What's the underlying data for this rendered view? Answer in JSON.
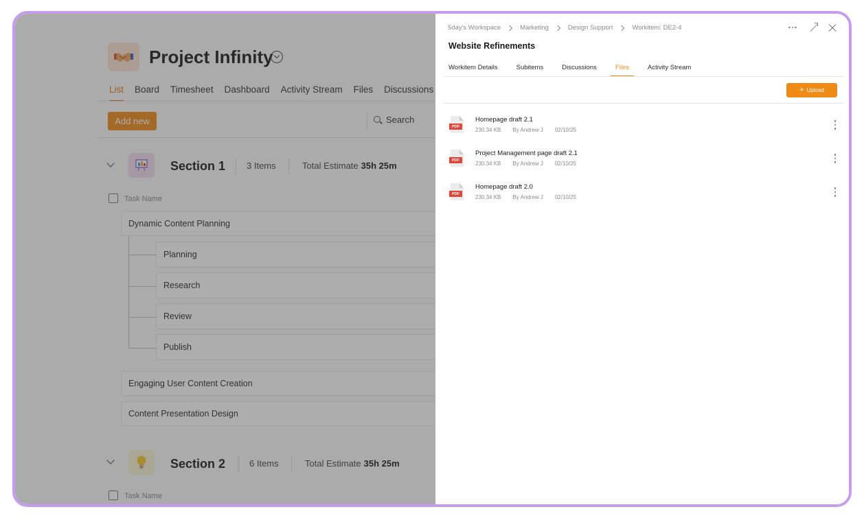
{
  "project": {
    "title": "Project Infinity",
    "tabs": [
      "List",
      "Board",
      "Timesheet",
      "Dashboard",
      "Activity Stream",
      "Files",
      "Discussions"
    ],
    "add_new_label": "Add new",
    "search_label": "Search"
  },
  "sections": [
    {
      "title": "Section 1",
      "count": "3 Items",
      "estimate_label": "Total Estimate",
      "estimate_value": "35h 25m",
      "task_header": "Task Name",
      "tasks": {
        "parent": "Dynamic Content Planning",
        "subtasks": [
          "Planning",
          "Research",
          "Review",
          "Publish"
        ],
        "others": [
          "Engaging User Content Creation",
          "Content Presentation Design"
        ]
      }
    },
    {
      "title": "Section 2",
      "count": "6 Items",
      "estimate_label": "Total Estimate",
      "estimate_value": "35h 25m",
      "task_header": "Task Name"
    }
  ],
  "drawer": {
    "breadcrumb": [
      "5day's Workspace",
      "Marketing",
      "Design Support",
      "Workitem: DE2-4"
    ],
    "title": "Website Refinements",
    "tabs": [
      "Workitem Details",
      "Subitems",
      "Discussions",
      "Files",
      "Activity Stream"
    ],
    "active_tab": "Files",
    "upload_label": "Upload",
    "file_type_badge": "PDF",
    "files": [
      {
        "name": "Homepage draft 2.1",
        "size": "230.34 KB",
        "author": "By Andrew J",
        "date": "02/10/25"
      },
      {
        "name": "Project Management page draft 2.1",
        "size": "230.34 KB",
        "author": "By Andrew J",
        "date": "02/10/25"
      },
      {
        "name": "Homepage draft 2.0",
        "size": "230.34 KB",
        "author": "By Andrew J",
        "date": "02/10/25"
      }
    ]
  },
  "colors": {
    "accent": "#f08a17",
    "frame_border": "#c79cf0",
    "pdf_badge": "#e2463a"
  }
}
